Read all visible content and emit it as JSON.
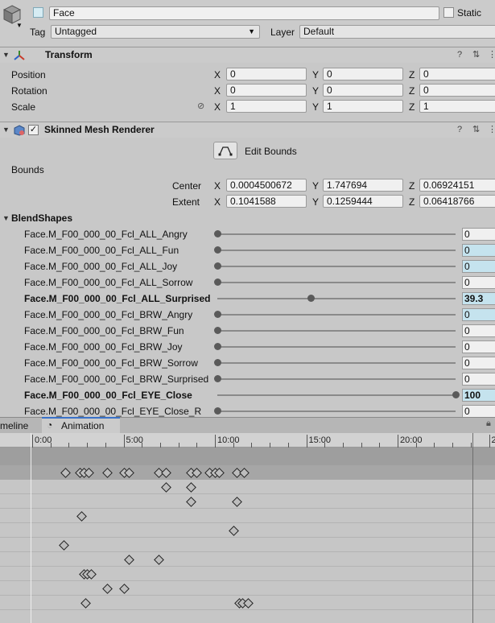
{
  "object": {
    "name": "Face",
    "static_label": "Static",
    "tag_label": "Tag",
    "tag_value": "Untagged",
    "layer_label": "Layer",
    "layer_value": "Default"
  },
  "transform": {
    "title": "Transform",
    "rows": [
      {
        "label": "Position",
        "x": "0",
        "y": "0",
        "z": "0"
      },
      {
        "label": "Rotation",
        "x": "0",
        "y": "0",
        "z": "0"
      },
      {
        "label": "Scale",
        "x": "1",
        "y": "1",
        "z": "1"
      }
    ],
    "axis_x": "X",
    "axis_y": "Y",
    "axis_z": "Z"
  },
  "skinned_mesh": {
    "title": "Skinned Mesh Renderer",
    "edit_bounds": "Edit Bounds",
    "bounds_label": "Bounds",
    "center_label": "Center",
    "center": {
      "x": "0.0004500672",
      "y": "1.747694",
      "z": "0.06924151"
    },
    "extent_label": "Extent",
    "extent": {
      "x": "0.1041588",
      "y": "0.1259444",
      "z": "0.06418766"
    }
  },
  "blendshapes": {
    "title": "BlendShapes",
    "items": [
      {
        "name": "Face.M_F00_000_00_Fcl_ALL_Angry",
        "value": "0",
        "level": 0,
        "bold": false,
        "highlight": false
      },
      {
        "name": "Face.M_F00_000_00_Fcl_ALL_Fun",
        "value": "0",
        "level": 0,
        "bold": false,
        "highlight": true
      },
      {
        "name": "Face.M_F00_000_00_Fcl_ALL_Joy",
        "value": "0",
        "level": 0,
        "bold": false,
        "highlight": true
      },
      {
        "name": "Face.M_F00_000_00_Fcl_ALL_Sorrow",
        "value": "0",
        "level": 0,
        "bold": false,
        "highlight": false
      },
      {
        "name": "Face.M_F00_000_00_Fcl_ALL_Surprised",
        "value": "39.3",
        "level": 0.393,
        "bold": true,
        "highlight": true
      },
      {
        "name": "Face.M_F00_000_00_Fcl_BRW_Angry",
        "value": "0",
        "level": 0,
        "bold": false,
        "highlight": true
      },
      {
        "name": "Face.M_F00_000_00_Fcl_BRW_Fun",
        "value": "0",
        "level": 0,
        "bold": false,
        "highlight": false
      },
      {
        "name": "Face.M_F00_000_00_Fcl_BRW_Joy",
        "value": "0",
        "level": 0,
        "bold": false,
        "highlight": false
      },
      {
        "name": "Face.M_F00_000_00_Fcl_BRW_Sorrow",
        "value": "0",
        "level": 0,
        "bold": false,
        "highlight": false
      },
      {
        "name": "Face.M_F00_000_00_Fcl_BRW_Surprised",
        "value": "0",
        "level": 0,
        "bold": false,
        "highlight": false
      },
      {
        "name": "Face.M_F00_000_00_Fcl_EYE_Close",
        "value": "100",
        "level": 1,
        "bold": true,
        "highlight": true
      },
      {
        "name": "Face.M_F00_000_00_Fcl_EYE_Close_R",
        "value": "0",
        "level": 0,
        "bold": false,
        "highlight": false
      }
    ]
  },
  "tabs": {
    "timeline": "meline",
    "animation": "Animation"
  },
  "timeline": {
    "ticks": [
      "0:00",
      "5:00",
      "10:00",
      "15:00",
      "20:00",
      "2"
    ],
    "summary_keys": [
      0.18,
      0.26,
      0.28,
      0.31,
      0.41,
      0.5,
      0.53,
      0.69,
      0.73,
      0.87,
      0.9,
      0.97,
      1.0,
      1.02,
      1.12,
      1.16
    ],
    "rows": [
      [
        0.73,
        0.87
      ],
      [
        0.87,
        1.12
      ],
      [
        0.27
      ],
      [
        1.1
      ],
      [
        0.17
      ],
      [
        0.53,
        0.69
      ],
      [
        0.28,
        0.3,
        0.32
      ],
      [
        0.41,
        0.5
      ],
      [
        0.29,
        1.13,
        1.15,
        1.18
      ]
    ]
  },
  "colors": {
    "highlight": "#c5e3ee",
    "panel": "#c8c8c8",
    "timeline_dark": "#9c9c9c"
  }
}
